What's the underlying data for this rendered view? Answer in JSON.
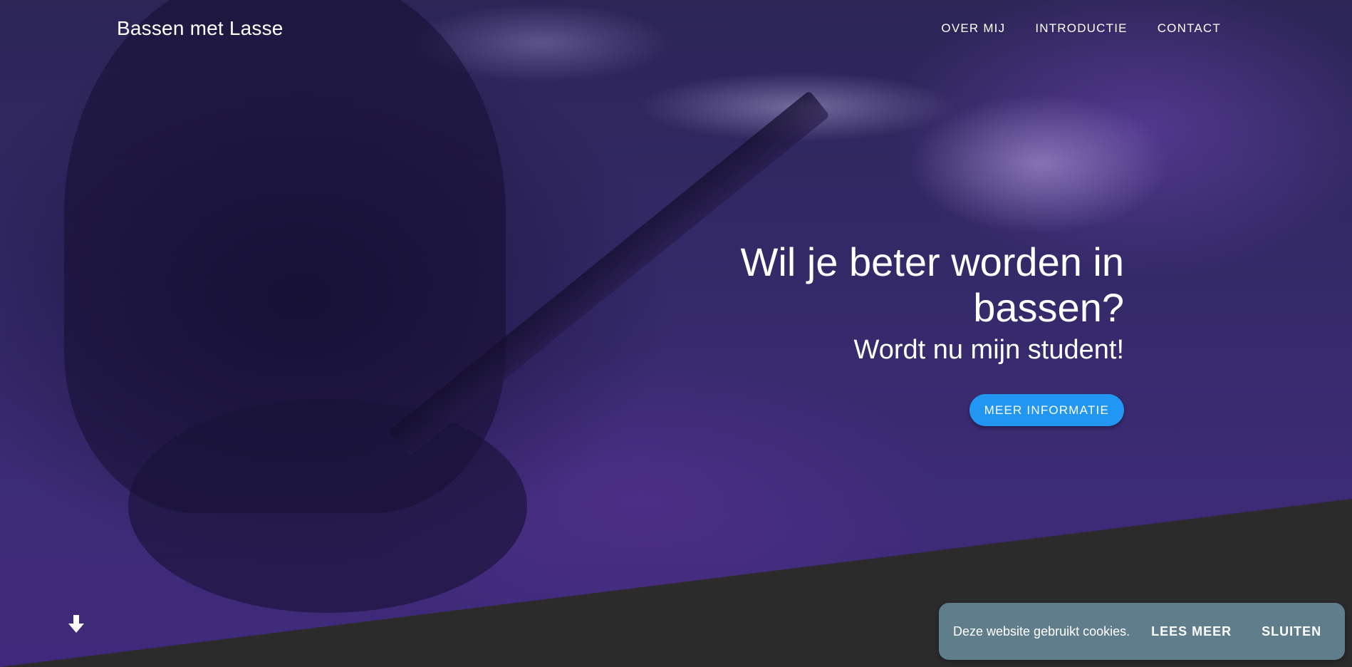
{
  "header": {
    "brand": "Bassen met Lasse",
    "nav": [
      "OVER MIJ",
      "INTRODUCTIE",
      "CONTACT"
    ]
  },
  "hero": {
    "headline": "Wil je beter worden in bassen?",
    "subline": "Wordt nu mijn student!",
    "cta_label": "MEER INFORMATIE",
    "scroll_icon": "arrow-down-icon"
  },
  "cookie_banner": {
    "text": "Deze website gebruikt cookies.",
    "read_more_label": "LEES MEER",
    "close_label": "SLUITEN"
  },
  "colors": {
    "accent": "#2196f3",
    "cookie_bg": "#607d8b",
    "footer_band": "#2b2b2b"
  }
}
